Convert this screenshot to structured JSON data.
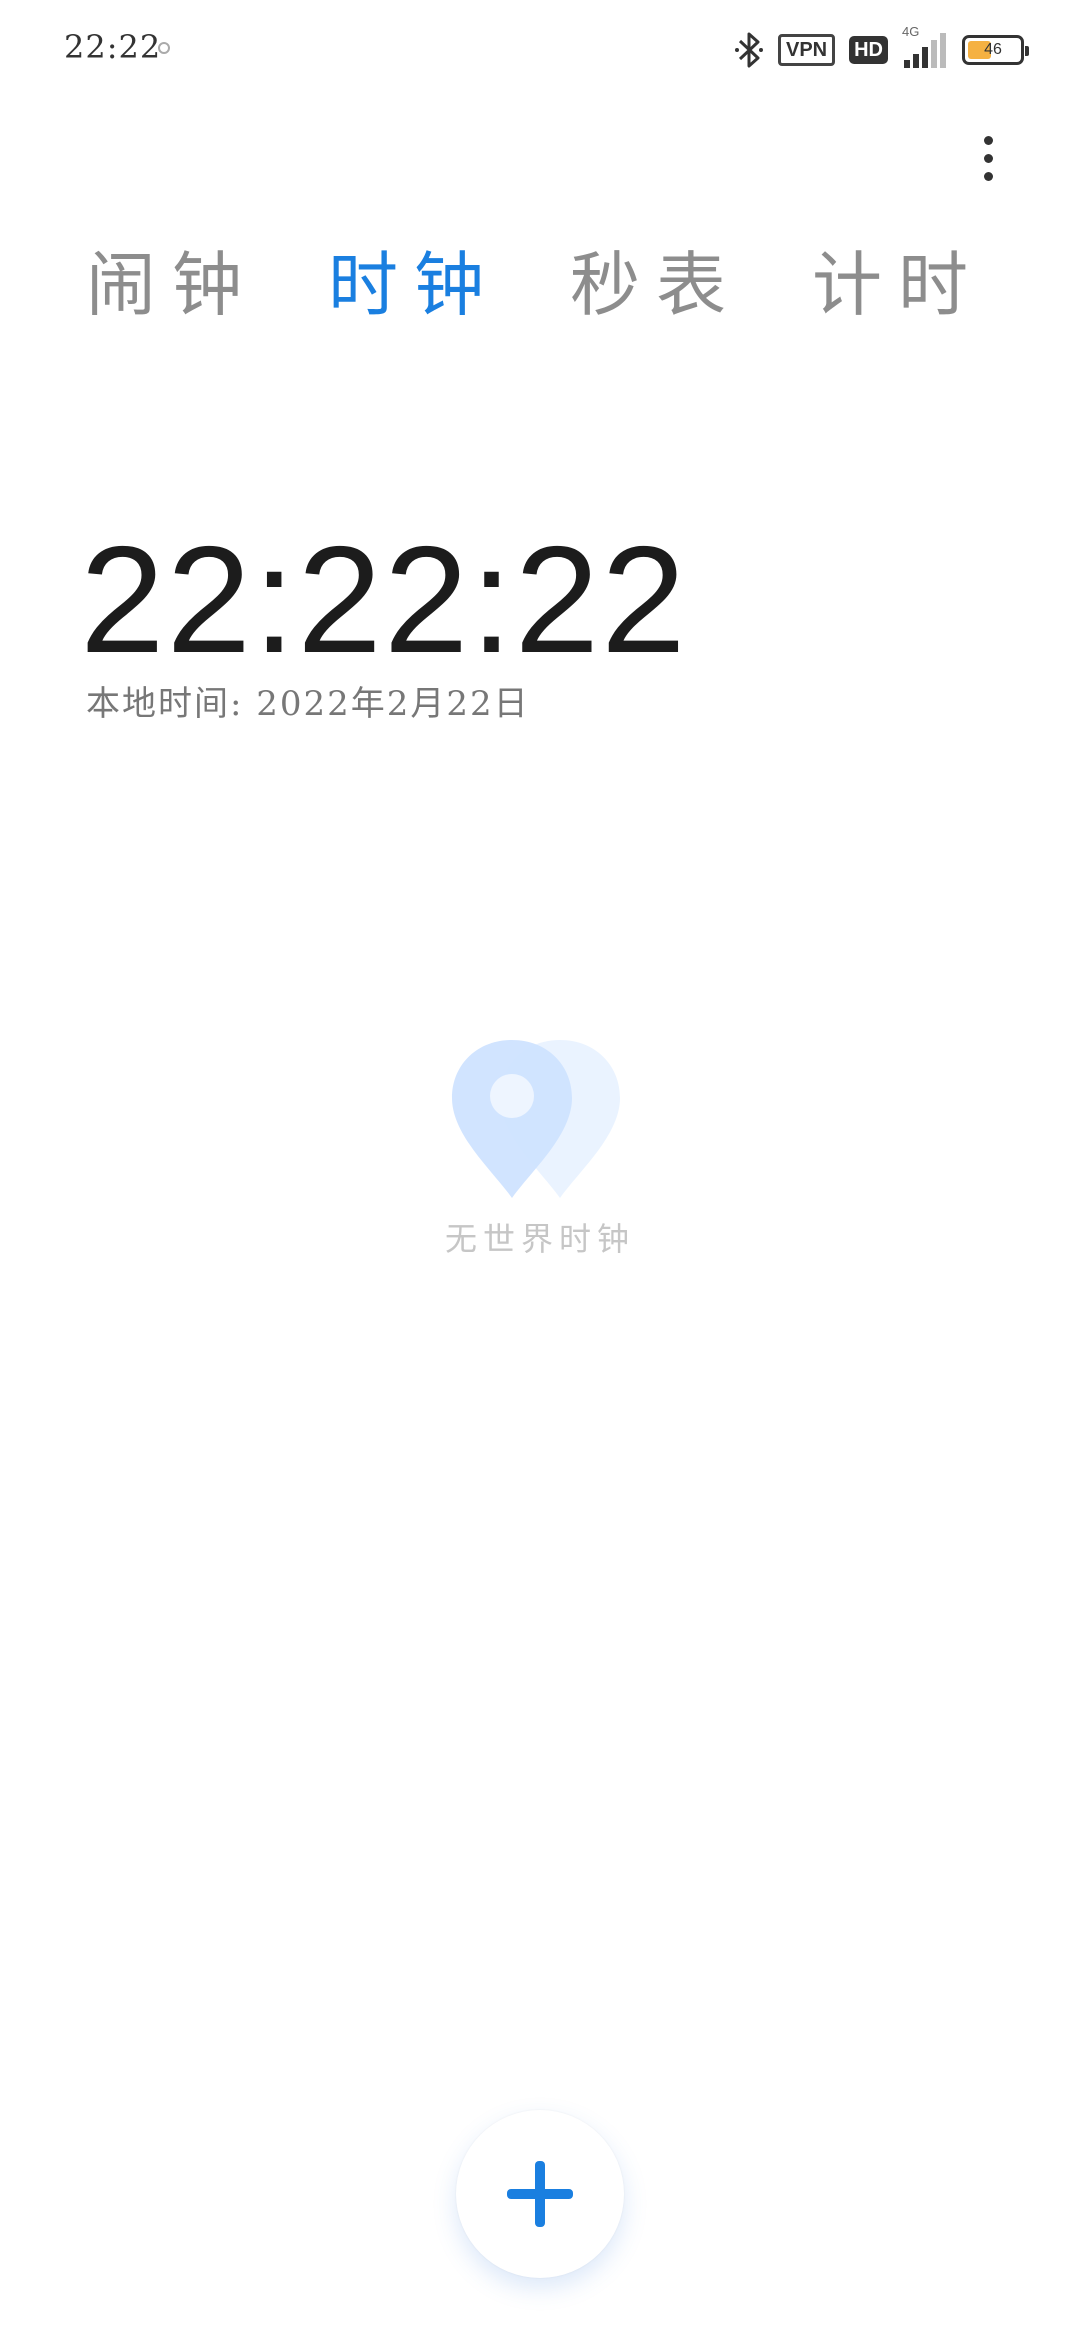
{
  "status_bar": {
    "time": "22:22",
    "vpn_label": "VPN",
    "hd_label": "HD",
    "network_label": "4G",
    "battery_level": "46",
    "battery_fraction": 0.46,
    "icons": [
      "bluetooth-icon",
      "signal-icon",
      "battery-icon"
    ]
  },
  "header": {
    "more_icon": "more-vert-icon"
  },
  "tabs": [
    {
      "label": "闹钟",
      "active": false
    },
    {
      "label": "时钟",
      "active": true
    },
    {
      "label": "秒表",
      "active": false
    },
    {
      "label": "计时",
      "active": false
    }
  ],
  "clock": {
    "time": "22:22:22",
    "date": "本地时间: 2022年2月22日"
  },
  "empty_state": {
    "icon": "location-pin-icon",
    "text": "无世界时钟"
  },
  "fab": {
    "icon": "plus-icon"
  },
  "colors": {
    "accent": "#1a7fe0",
    "inactive_tab": "#8d8d8d",
    "battery": "#f5b142"
  }
}
